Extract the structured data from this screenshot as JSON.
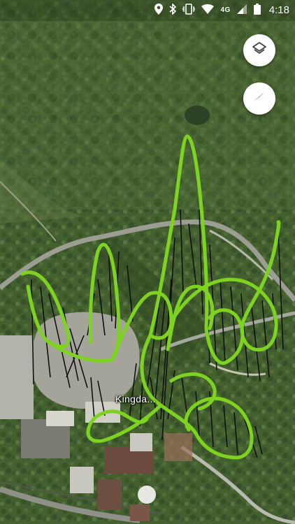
{
  "status_bar": {
    "network": "4G",
    "time": "4:18",
    "icons": [
      "location-icon",
      "bluetooth-icon",
      "vibrate-icon",
      "wifi-icon",
      "signal-icon",
      "battery-icon"
    ]
  },
  "map": {
    "type": "satellite",
    "place_label": "Kingda...",
    "overlay_color": "#7ed321",
    "support_color": "#111111"
  },
  "controls": {
    "layers_button": "layers-icon",
    "compass_button": "compass-icon"
  }
}
